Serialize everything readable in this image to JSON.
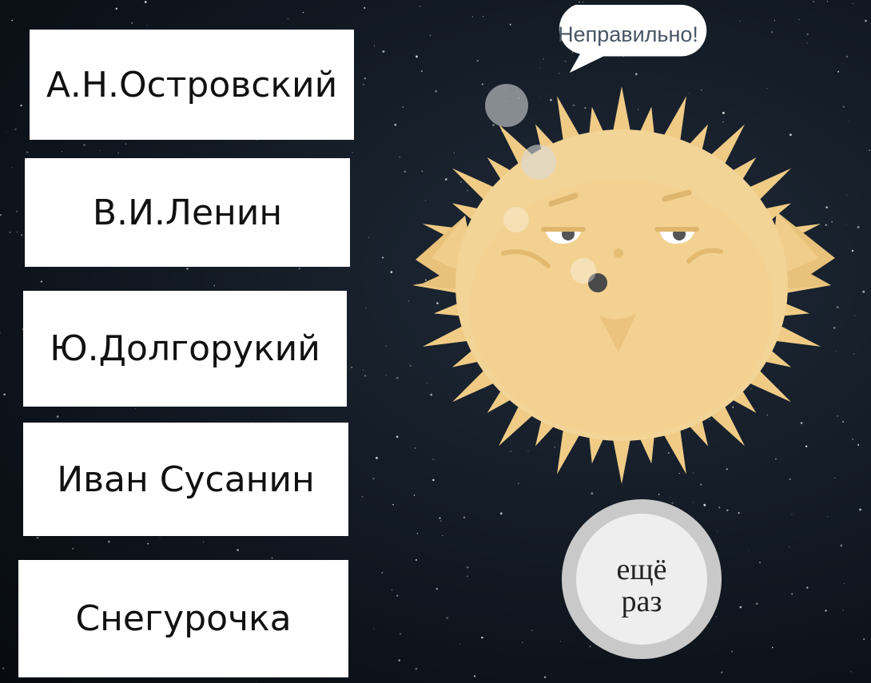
{
  "answers": [
    {
      "label": "А.Н.Островский"
    },
    {
      "label": "В.И.Ленин"
    },
    {
      "label": "Ю.Долгорукий"
    },
    {
      "label": "Иван Сусанин"
    },
    {
      "label": "Снегурочка"
    }
  ],
  "feedback": {
    "text": "Неправильно!"
  },
  "retry": {
    "line1": "ещё",
    "line2": "раз"
  },
  "colors": {
    "background": "#111821",
    "answer_bg": "#ffffff",
    "fish_body": "#f3d497",
    "fish_spikes": "#efcb86",
    "retry_ring": "#c9c9c9",
    "retry_face": "#eeeeee",
    "bubble_text": "#4a5564"
  },
  "icons": {
    "character": "pufferfish-character-icon",
    "speech": "speech-bubble-icon"
  }
}
